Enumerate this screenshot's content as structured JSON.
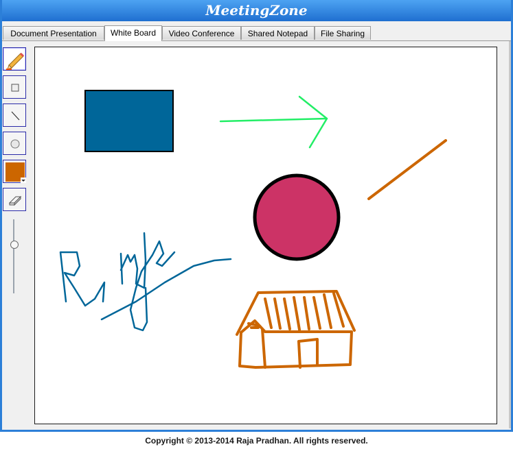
{
  "app": {
    "title": "MeetingZone"
  },
  "tabs": [
    {
      "label": "Document Presentation",
      "active": false
    },
    {
      "label": "White Board",
      "active": true
    },
    {
      "label": "Video Conference",
      "active": false
    },
    {
      "label": "Shared Notepad",
      "active": false
    },
    {
      "label": "File Sharing",
      "active": false
    }
  ],
  "toolbox": {
    "tools": [
      {
        "icon": "pencil-icon"
      },
      {
        "icon": "rectangle-icon"
      },
      {
        "icon": "line-icon"
      },
      {
        "icon": "circle-icon"
      },
      {
        "icon": "color-picker-icon",
        "color": "#cc6600"
      },
      {
        "icon": "eraser-icon"
      }
    ],
    "brush_size_level": 0.33
  },
  "whiteboard": {
    "colors": {
      "rectangle_fill": "#006699",
      "arrow": "#22ee66",
      "circle_fill": "#cc3366",
      "line": "#cc6600",
      "signature": "#006699",
      "house": "#cc6600"
    }
  },
  "footer": {
    "copyright": "Copyright © 2013-2014  Raja Pradhan. All rights reserved."
  }
}
